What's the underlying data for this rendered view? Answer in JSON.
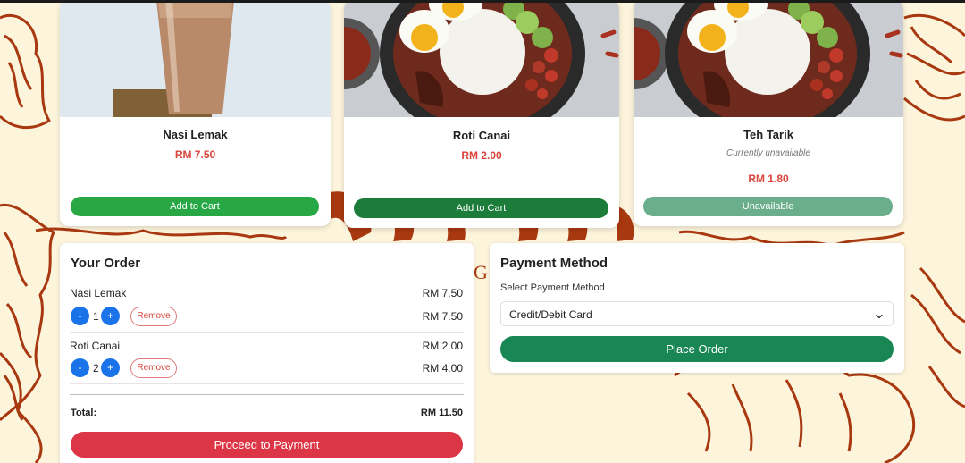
{
  "menu": {
    "items": [
      {
        "name": "Nasi Lemak",
        "price": "RM 7.50",
        "button_label": "Add to Cart",
        "note": "",
        "available": true
      },
      {
        "name": "Roti Canai",
        "price": "RM 2.00",
        "button_label": "Add to Cart",
        "note": "",
        "available": true
      },
      {
        "name": "Teh Tarik",
        "price": "RM 1.80",
        "button_label": "Unavailable",
        "note": "Currently unavailable",
        "available": false
      }
    ]
  },
  "order": {
    "title": "Your Order",
    "items": [
      {
        "name": "Nasi Lemak",
        "unit_price": "RM 7.50",
        "quantity": "1",
        "line_total": "RM 7.50",
        "minus": "-",
        "plus": "+",
        "remove_label": "Remove"
      },
      {
        "name": "Roti Canai",
        "unit_price": "RM 2.00",
        "quantity": "2",
        "line_total": "RM 4.00",
        "minus": "-",
        "plus": "+",
        "remove_label": "Remove"
      }
    ],
    "total_label": "Total:",
    "total_value": "RM 11.50",
    "proceed_label": "Proceed to Payment"
  },
  "payment": {
    "title": "Payment Method",
    "select_label": "Select Payment Method",
    "selected_option": "Credit/Debit Card",
    "place_order_label": "Place Order"
  },
  "colors": {
    "add_to_cart": "#28a745",
    "add_to_cart_hover": "#1c7d3a",
    "unavailable": "#6aae8c",
    "price": "#d9453c",
    "proceed": "#dc3545",
    "place_order": "#198754",
    "qty_button": "#1a73e8",
    "background": "#fdf4dc",
    "pattern": "#a8380f"
  },
  "icons": {
    "select_chevron": "chevron-down-icon"
  }
}
